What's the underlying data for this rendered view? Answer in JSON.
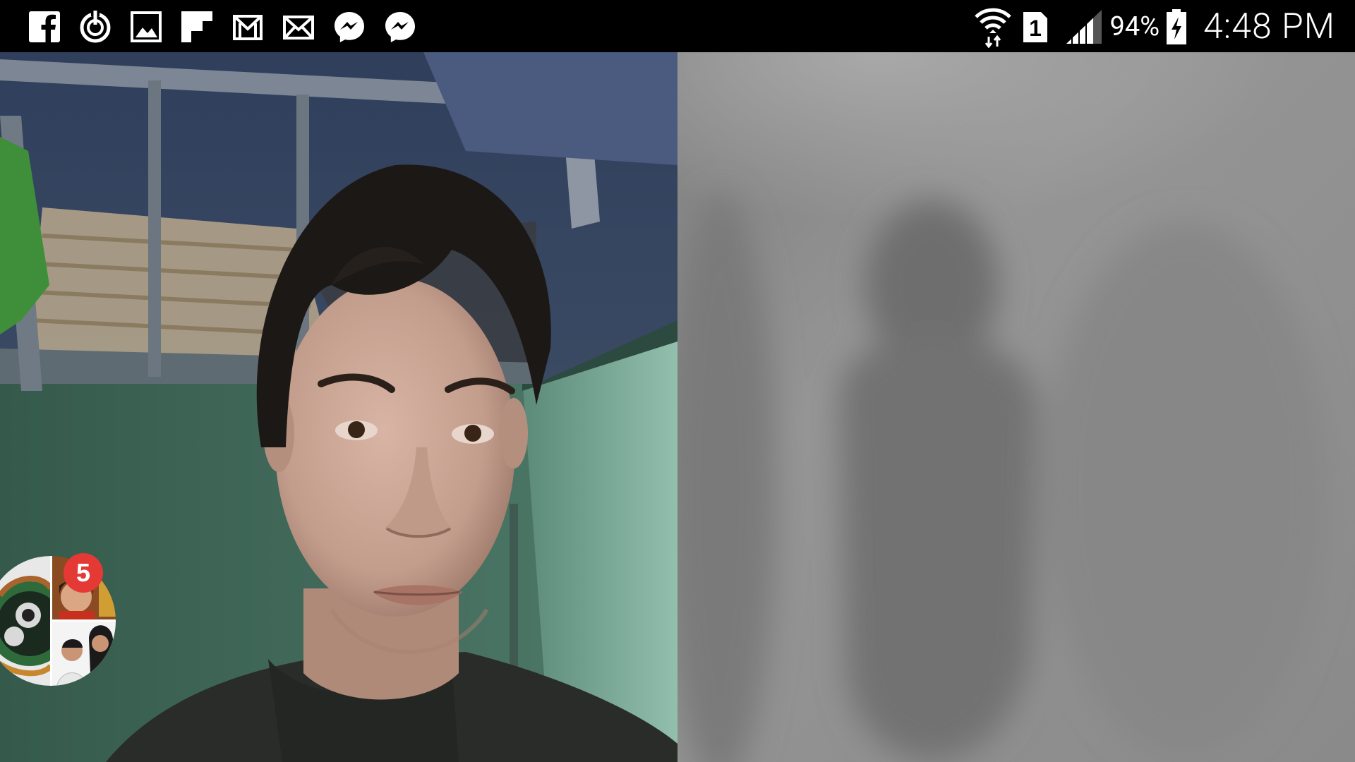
{
  "status_bar": {
    "notification_icons": [
      "facebook-icon",
      "power-icon",
      "gallery-icon",
      "flipboard-icon",
      "gmail-icon",
      "email-icon",
      "messenger-icon",
      "messenger-icon-2"
    ],
    "battery_percent": "94%",
    "time": "4:48 PM",
    "sim_slot": "1"
  },
  "video_call": {
    "local_pane": "self-camera",
    "remote_pane": "remote-camera-blurred"
  },
  "chat_heads": {
    "unread_count": "5"
  },
  "colors": {
    "status_bar_bg": "#000000",
    "badge": "#e53935",
    "remote_video_gray": "#8c8c8c"
  }
}
